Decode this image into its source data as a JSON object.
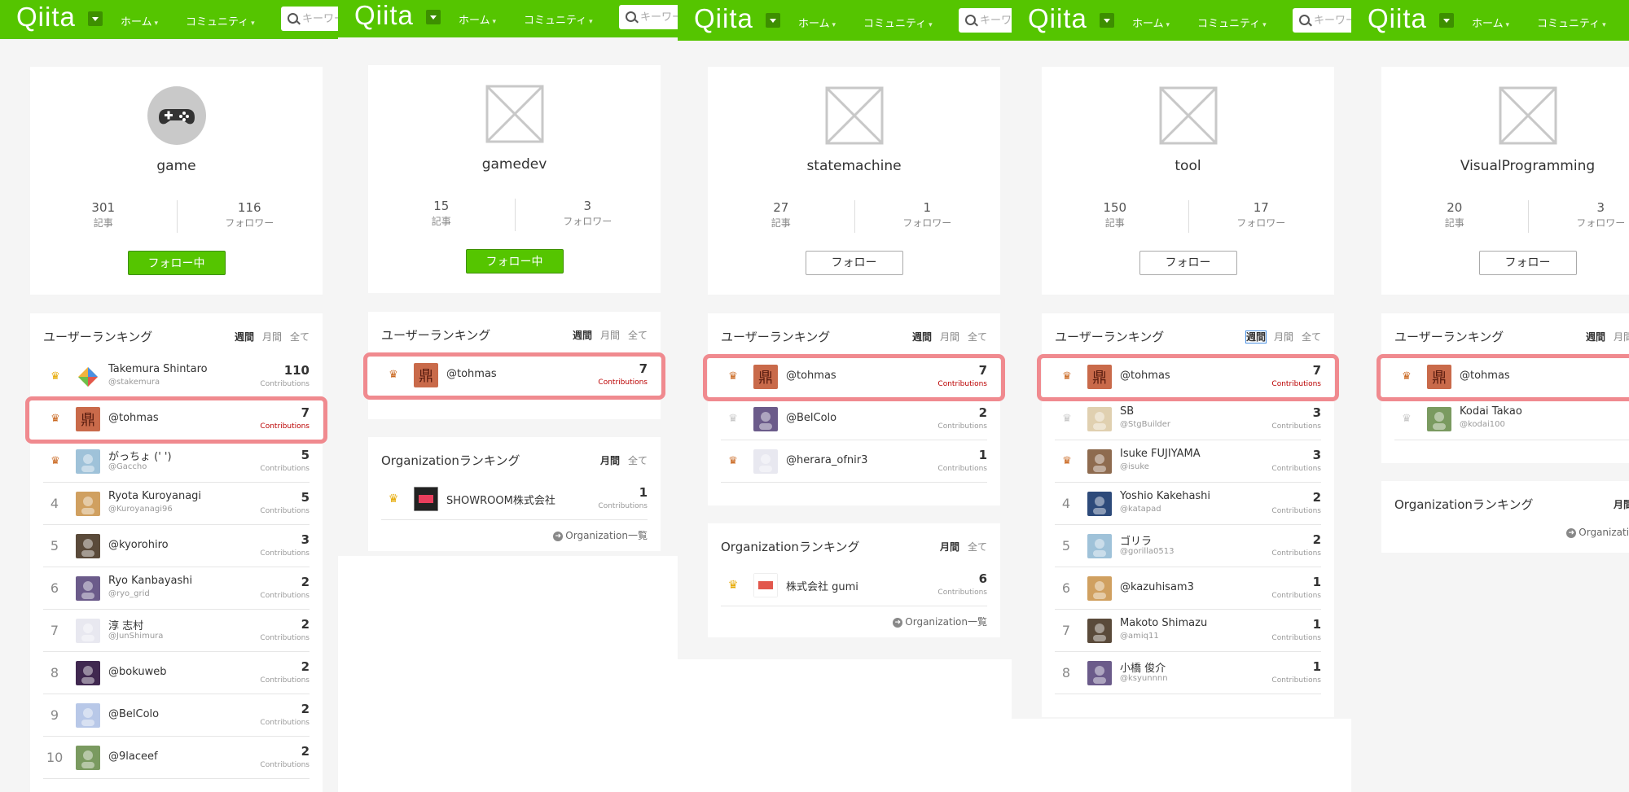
{
  "header": {
    "logo": "Qiita",
    "nav_home": "ホーム",
    "nav_community": "コミュニティ",
    "search_placeholder": "キーワード"
  },
  "labels": {
    "articles": "記事",
    "followers": "フォロワー",
    "user_ranking": "ユーザーランキング",
    "org_ranking": "Organizationランキング",
    "weekly": "週間",
    "monthly": "月間",
    "all": "全て",
    "contributions": "Contributions",
    "following": "フォロー中",
    "follow": "フォロー",
    "org_list": "Organization一覧"
  },
  "colors": {
    "brand": "#55c500",
    "highlight": "#f08a8f"
  },
  "panels": [
    {
      "tag": "game",
      "articles": "301",
      "followers": "116",
      "followed": true,
      "users": [
        {
          "rank": "1",
          "trophy": "gold",
          "name": "Takemura Shintaro",
          "id": "@stakemura",
          "count": "110"
        },
        {
          "rank": "2",
          "trophy": "bronze",
          "name": "@tohmas",
          "id": "",
          "count": "7",
          "highlight": true
        },
        {
          "rank": "3",
          "trophy": "bronze",
          "name": "がっちょ (' ')",
          "id": "@Gaccho",
          "count": "5"
        },
        {
          "rank": "4",
          "name": "Ryota Kuroyanagi",
          "id": "@Kuroyanagi96",
          "count": "5"
        },
        {
          "rank": "5",
          "name": "@kyorohiro",
          "id": "",
          "count": "3"
        },
        {
          "rank": "6",
          "name": "Ryo Kanbayashi",
          "id": "@ryo_grid",
          "count": "2"
        },
        {
          "rank": "7",
          "name": "淳 志村",
          "id": "@JunShimura",
          "count": "2"
        },
        {
          "rank": "8",
          "name": "@bokuweb",
          "id": "",
          "count": "2"
        },
        {
          "rank": "9",
          "name": "@BelColo",
          "id": "",
          "count": "2"
        },
        {
          "rank": "10",
          "name": "@9laceef",
          "id": "",
          "count": "2"
        }
      ],
      "orgs": []
    },
    {
      "tag": "gamedev",
      "articles": "15",
      "followers": "3",
      "followed": true,
      "users": [
        {
          "rank": "1",
          "trophy": "bronze",
          "name": "@tohmas",
          "id": "",
          "count": "7",
          "highlight": true
        }
      ],
      "orgs": [
        {
          "trophy": "gold",
          "name": "SHOWROOM株式会社",
          "count": "1"
        }
      ]
    },
    {
      "tag": "statemachine",
      "articles": "27",
      "followers": "1",
      "followed": false,
      "users": [
        {
          "rank": "1",
          "trophy": "bronze",
          "name": "@tohmas",
          "id": "",
          "count": "7",
          "highlight": true
        },
        {
          "rank": "2",
          "trophy": "silver",
          "name": "@BelColo",
          "id": "",
          "count": "2"
        },
        {
          "rank": "3",
          "trophy": "bronze",
          "name": "@herara_ofnir3",
          "id": "",
          "count": "1"
        }
      ],
      "orgs": [
        {
          "trophy": "gold",
          "name": "株式会社 gumi",
          "count": "6"
        }
      ]
    },
    {
      "tag": "tool",
      "articles": "150",
      "followers": "17",
      "followed": false,
      "users": [
        {
          "rank": "1",
          "trophy": "bronze",
          "name": "@tohmas",
          "id": "",
          "count": "7",
          "highlight": true
        },
        {
          "rank": "2",
          "trophy": "silver",
          "name": "SB",
          "id": "@StgBuilder",
          "count": "3"
        },
        {
          "rank": "3",
          "trophy": "bronze",
          "name": "Isuke FUJIYAMA",
          "id": "@isuke",
          "count": "3"
        },
        {
          "rank": "4",
          "name": "Yoshio Kakehashi",
          "id": "@katapad",
          "count": "2"
        },
        {
          "rank": "5",
          "name": "ゴリラ",
          "id": "@gorilla0513",
          "count": "2"
        },
        {
          "rank": "6",
          "name": "@kazuhisam3",
          "id": "",
          "count": "1"
        },
        {
          "rank": "7",
          "name": "Makoto Shimazu",
          "id": "@amiq11",
          "count": "1"
        },
        {
          "rank": "8",
          "name": "小橋 俊介",
          "id": "@ksyunnnn",
          "count": "1"
        }
      ],
      "orgs": []
    },
    {
      "tag": "VisualProgramming",
      "articles": "20",
      "followers": "3",
      "followed": false,
      "users": [
        {
          "rank": "1",
          "trophy": "bronze",
          "name": "@tohmas",
          "id": "",
          "count": "",
          "highlight": true
        },
        {
          "rank": "2",
          "trophy": "silver",
          "name": "Kodai Takao",
          "id": "@kodai100",
          "count": ""
        }
      ],
      "orgs": []
    }
  ]
}
